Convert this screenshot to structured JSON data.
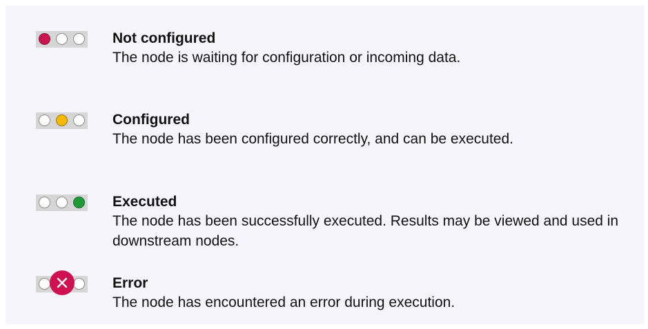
{
  "statuses": [
    {
      "title": "Not configured",
      "description": "The node is waiting for configuration or incoming data.",
      "indicator": "red-light",
      "color": "#c8154f"
    },
    {
      "title": "Configured",
      "description": "The node has been configured correctly, and can be executed.",
      "indicator": "yellow-light",
      "color": "#f6b800"
    },
    {
      "title": "Executed",
      "description": "The node has been successfully executed. Results may be viewed and used in downstream nodes.",
      "indicator": "green-light",
      "color": "#1e9a39"
    },
    {
      "title": "Error",
      "description": "The node has encountered an error during execution.",
      "indicator": "error-cross",
      "color": "#cf1151"
    }
  ]
}
